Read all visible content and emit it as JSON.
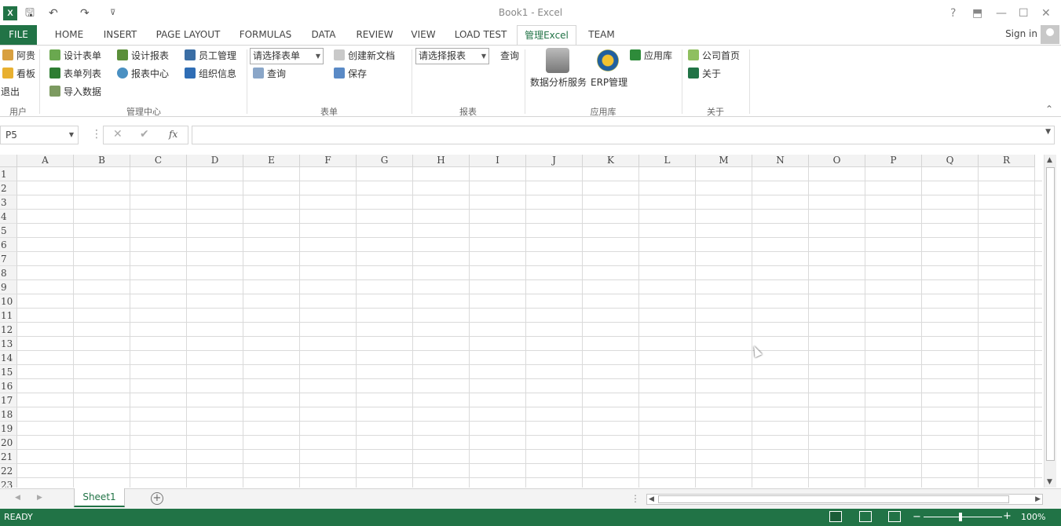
{
  "window": {
    "title": "Book1 - Excel",
    "help": "?",
    "restore": "⬒",
    "minimize": "—",
    "maximize": "☐",
    "close": "✕"
  },
  "qat": {
    "save": "🖫",
    "undo": "↶",
    "redo": "↷",
    "customize": "⊽"
  },
  "tabs": {
    "file": "FILE",
    "home": "HOME",
    "insert": "INSERT",
    "page_layout": "PAGE LAYOUT",
    "formulas": "FORMULAS",
    "data": "DATA",
    "review": "REVIEW",
    "view": "VIEW",
    "load_test": "LOAD TEST",
    "manage_excel": "管理Excel",
    "team": "TEAM"
  },
  "account": {
    "signin": "Sign in"
  },
  "ribbon": {
    "user_group": {
      "label": "用户",
      "agui": "阿贵",
      "kanban": "看板",
      "logout": "退出"
    },
    "mgmt_group": {
      "label": "管理中心",
      "design_form": "设计表单",
      "form_list": "表单列表",
      "import_data": "导入数据",
      "design_report": "设计报表",
      "report_center": "报表中心",
      "staff_mgmt": "员工管理",
      "org_info": "组织信息"
    },
    "form_group": {
      "label": "表单",
      "select_form": "请选择表单",
      "query": "查询",
      "new_doc": "创建新文档",
      "save": "保存"
    },
    "report_group": {
      "label": "报表",
      "select_report": "请选择报表",
      "query": "查询"
    },
    "app_group": {
      "label": "应用库",
      "data_service": "数据分析服务",
      "erp": "ERP管理",
      "app_store": "应用库"
    },
    "about_group": {
      "label": "关于",
      "homepage": "公司首页",
      "about": "关于"
    },
    "collapse": "⌃"
  },
  "formula_bar": {
    "name_box": "P5",
    "cancel": "✕",
    "enter": "✔",
    "fx": "fx",
    "value": ""
  },
  "columns": [
    "A",
    "B",
    "C",
    "D",
    "E",
    "F",
    "G",
    "H",
    "I",
    "J",
    "K",
    "L",
    "M",
    "N",
    "O",
    "P",
    "Q",
    "R"
  ],
  "rows": [
    "1",
    "2",
    "3",
    "4",
    "5",
    "6",
    "7",
    "8",
    "9",
    "10",
    "11",
    "12",
    "13",
    "14",
    "15",
    "16",
    "17",
    "18",
    "19",
    "20",
    "21",
    "22",
    "23"
  ],
  "sheets": {
    "active": "Sheet1",
    "add": "+"
  },
  "status": {
    "mode": "READY",
    "zoom": "100%",
    "zoom_out": "−",
    "zoom_in": "+"
  },
  "colors": {
    "accent": "#217346"
  }
}
